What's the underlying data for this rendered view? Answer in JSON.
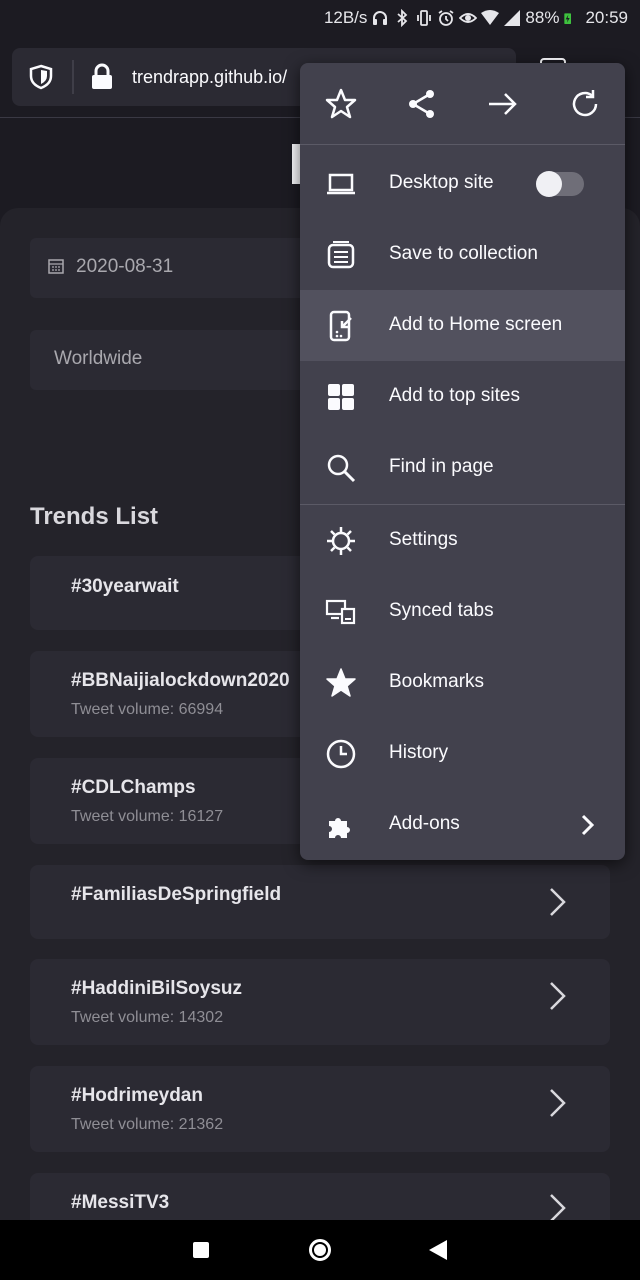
{
  "status_bar": {
    "speed": "12B/s",
    "battery": "88%",
    "time": "20:59"
  },
  "browser": {
    "url": "trendrapp.github.io/"
  },
  "page": {
    "date_value": "2020-08-31",
    "region_value": "Worldwide",
    "trends_title": "Trends List",
    "trends": [
      {
        "name": "#30yearwait",
        "volume": ""
      },
      {
        "name": "#BBNaijialockdown2020",
        "volume": "Tweet volume: 66994"
      },
      {
        "name": "#CDLChamps",
        "volume": "Tweet volume: 16127"
      },
      {
        "name": "#FamiliasDeSpringfield",
        "volume": ""
      },
      {
        "name": "#HaddiniBilSoysuz",
        "volume": "Tweet volume: 14302"
      },
      {
        "name": "#Hodrimeydan",
        "volume": "Tweet volume: 21362"
      },
      {
        "name": "#MessiTV3",
        "volume": ""
      }
    ]
  },
  "menu": {
    "top_icons": [
      "star-outline-icon",
      "share-icon",
      "forward-arrow-icon",
      "reload-icon"
    ],
    "items": [
      {
        "label": "Desktop site",
        "icon": "laptop-icon"
      },
      {
        "label": "Save to collection",
        "icon": "collection-icon"
      },
      {
        "label": "Add to Home screen",
        "icon": "add-to-home-icon"
      },
      {
        "label": "Add to top sites",
        "icon": "grid-icon"
      },
      {
        "label": "Find in page",
        "icon": "search-icon"
      },
      {
        "label": "Settings",
        "icon": "gear-icon"
      },
      {
        "label": "Synced tabs",
        "icon": "synced-tabs-icon"
      },
      {
        "label": "Bookmarks",
        "icon": "star-filled-icon"
      },
      {
        "label": "History",
        "icon": "clock-icon"
      },
      {
        "label": "Add-ons",
        "icon": "puzzle-icon"
      }
    ],
    "desktop_site_enabled": false
  },
  "colors": {
    "background": "#1c1b22",
    "panel": "#24232a",
    "card": "#2b2a33",
    "menu": "#42414d",
    "menu_highlight": "#52515e"
  }
}
